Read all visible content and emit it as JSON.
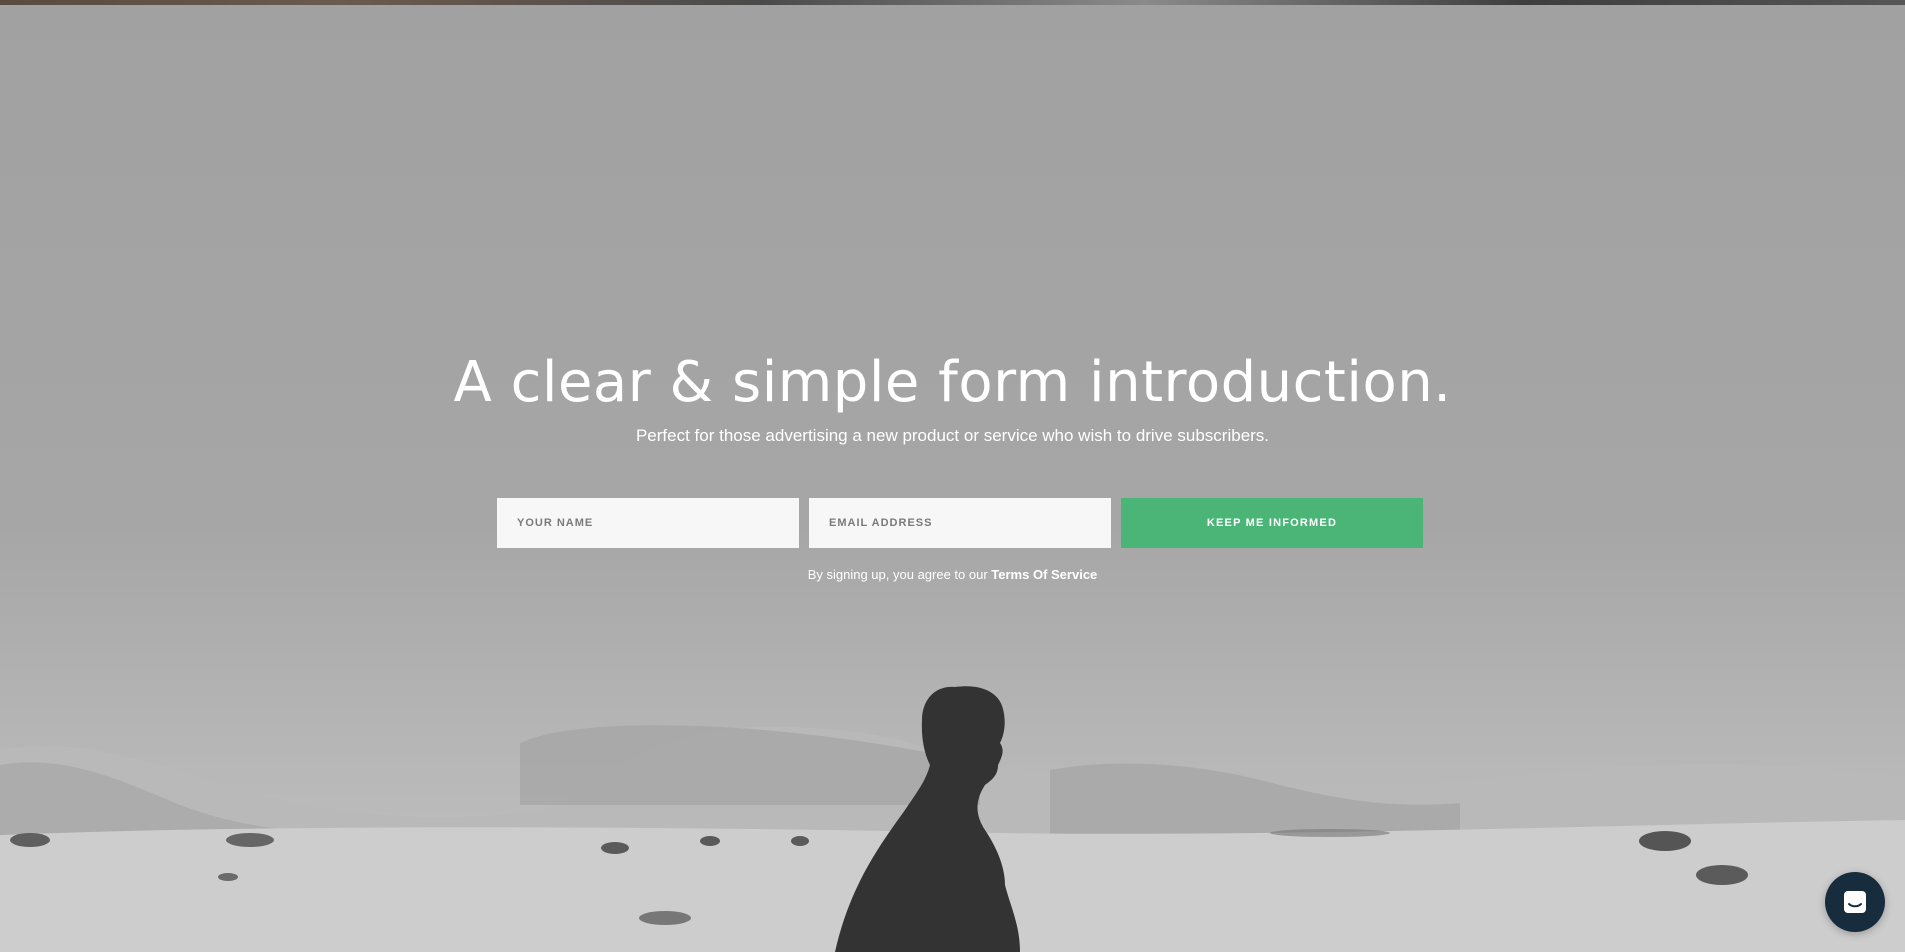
{
  "hero": {
    "headline": "A clear & simple form introduction.",
    "subline": "Perfect for those advertising a new product or service who wish to drive subscribers."
  },
  "form": {
    "name_placeholder": "YOUR NAME",
    "email_placeholder": "EMAIL ADDRESS",
    "submit_label": "KEEP ME INFORMED",
    "submit_color": "#4ab577"
  },
  "terms": {
    "prefix": "By signing up, you agree to our",
    "link_label": "Terms Of Service"
  },
  "chat": {
    "icon": "chat-icon",
    "color": "#172d3e"
  }
}
